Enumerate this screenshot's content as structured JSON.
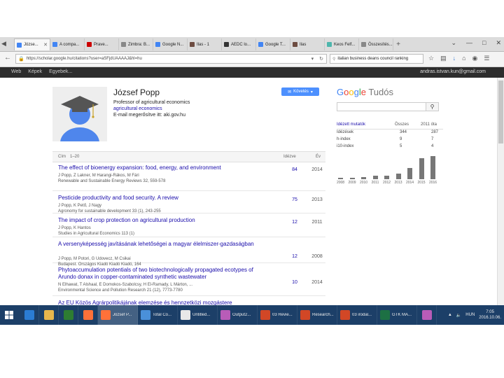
{
  "browser": {
    "tabs": [
      {
        "label": "Józse...",
        "favicon_color": "#4285f4",
        "active": true
      },
      {
        "label": "A compa...",
        "favicon_color": "#4285f4",
        "active": false
      },
      {
        "label": "Prave...",
        "favicon_color": "#cc0000",
        "active": false
      },
      {
        "label": "Zimbra: B...",
        "favicon_color": "#888888",
        "active": false
      },
      {
        "label": "Google N...",
        "favicon_color": "#4285f4",
        "active": false
      },
      {
        "label": "Ilas - 1",
        "favicon_color": "#6d4c41",
        "active": false
      },
      {
        "label": "AEDC lo...",
        "favicon_color": "#333333",
        "active": false
      },
      {
        "label": "Google T...",
        "favicon_color": "#4285f4",
        "active": false
      },
      {
        "label": "Ilas",
        "favicon_color": "#6d4c41",
        "active": false
      },
      {
        "label": "Keos Felf...",
        "favicon_color": "#4db6ac",
        "active": false
      },
      {
        "label": "Összesítés...",
        "favicon_color": "#888888",
        "active": false
      }
    ],
    "url": "https://scholar.google.hu/citations?user=aSFjdUAAAAJ&hl=hu",
    "search_value": "italian business deans council ranking"
  },
  "gbar": {
    "links": [
      "Web",
      "Képek",
      "Egyebek..."
    ],
    "email": "andras.istvan.kun@gmail.com"
  },
  "profile": {
    "name": "József Popp",
    "title": "Professor of agricultural economics",
    "interest": "agricultural economics",
    "email": "E-mail megerősítve itt: aki.gov.hu",
    "follow_label": "Követés"
  },
  "table": {
    "header_title": "Cím",
    "header_range": "1–20",
    "header_cited": "Idézve",
    "header_year": "Év",
    "rows": [
      {
        "title": "The effect of bioenergy expansion: food, energy, and environment",
        "authors": "J Popp, Z Lakner, M Harangi-Rákos, M Fári",
        "venue": "Renewable and Sustainable Energy Reviews 32, 559-578",
        "cited": "84",
        "year": "2014"
      },
      {
        "title": "Pesticide productivity and food security. A review",
        "authors": "J Popp, K Pető, J Nagy",
        "venue": "Agronomy for sustainable development 33 (1), 243-255",
        "cited": "75",
        "year": "2013"
      },
      {
        "title": "The impact of crop protection on agricultural production",
        "authors": "J Popp, K Hantos",
        "venue": "Studies in Agricultural Economics 113 (1)",
        "cited": "12",
        "year": "2011"
      },
      {
        "title": "A versenyképesség javításának lehetőségei a magyar élelmiszer-gazdaságban",
        "authors": "J Popp, M Potori, G Udovecz, M Csikai",
        "venue": "Budapest. Országos Kiadó Kiadó Kiadó, 164",
        "cited": "12",
        "year": "2008"
      },
      {
        "title": "Phytoaccumulation potentials of two biotechnologically propagated ecotypes of Arundo donax in copper-contaminated synthetic wastewater",
        "authors": "N Elhawat, T Alshaal, E Domokos-Szabolcsy, H El-Ramady, L Márton, ...",
        "venue": "Environmental Science and Pollution Research 21 (12), 7773-7780",
        "cited": "10",
        "year": "2014"
      },
      {
        "title": "Az EU Közös Agrárpolitikájának elemzése és hennzetközi mozgástere",
        "authors": "",
        "venue": "",
        "cited": "",
        "year": ""
      }
    ]
  },
  "sidebar": {
    "logo_google": "Google",
    "logo_tudos": "Tudós",
    "metrics_title": "Idézett mutatók",
    "col_all": "Összes",
    "col_since": "2011 óta",
    "rows": [
      {
        "label": "Idézések",
        "all": "344",
        "since": "287"
      },
      {
        "label": "h-index",
        "all": "9",
        "since": "7"
      },
      {
        "label": "i10-index",
        "all": "5",
        "since": "4"
      }
    ]
  },
  "chart_data": {
    "type": "bar",
    "categories": [
      "2008",
      "2009",
      "2010",
      "2011",
      "2012",
      "2013",
      "2014",
      "2015",
      "2016"
    ],
    "values": [
      3,
      4,
      6,
      9,
      9,
      14,
      30,
      55,
      60
    ],
    "ylim": [
      0,
      70
    ],
    "bar_color": "#777777"
  },
  "taskbar": {
    "apps": [
      {
        "label": "",
        "color": "#2b7cd3",
        "pinned": true
      },
      {
        "label": "",
        "color": "#e8b64c",
        "pinned": true
      },
      {
        "label": "",
        "color": "#2e7d32",
        "pinned": true
      },
      {
        "label": "",
        "color": "#ff7139",
        "pinned": true
      },
      {
        "label": "József P...",
        "color": "#ff7139",
        "active": true
      },
      {
        "label": "Total Co...",
        "color": "#4a90d9"
      },
      {
        "label": "Untitled...",
        "color": "#e8e8e8"
      },
      {
        "label": "Output2...",
        "color": "#b85cb8"
      },
      {
        "label": "03 Revie...",
        "color": "#d24726"
      },
      {
        "label": "Research...",
        "color": "#d24726"
      },
      {
        "label": "03 irodal...",
        "color": "#d24726"
      },
      {
        "label": "GTK MA...",
        "color": "#1d7044"
      },
      {
        "label": "",
        "color": "#b85cb8",
        "pinned": true
      }
    ],
    "lang": "HUN",
    "time": "7:05",
    "date": "2016.10.06."
  }
}
